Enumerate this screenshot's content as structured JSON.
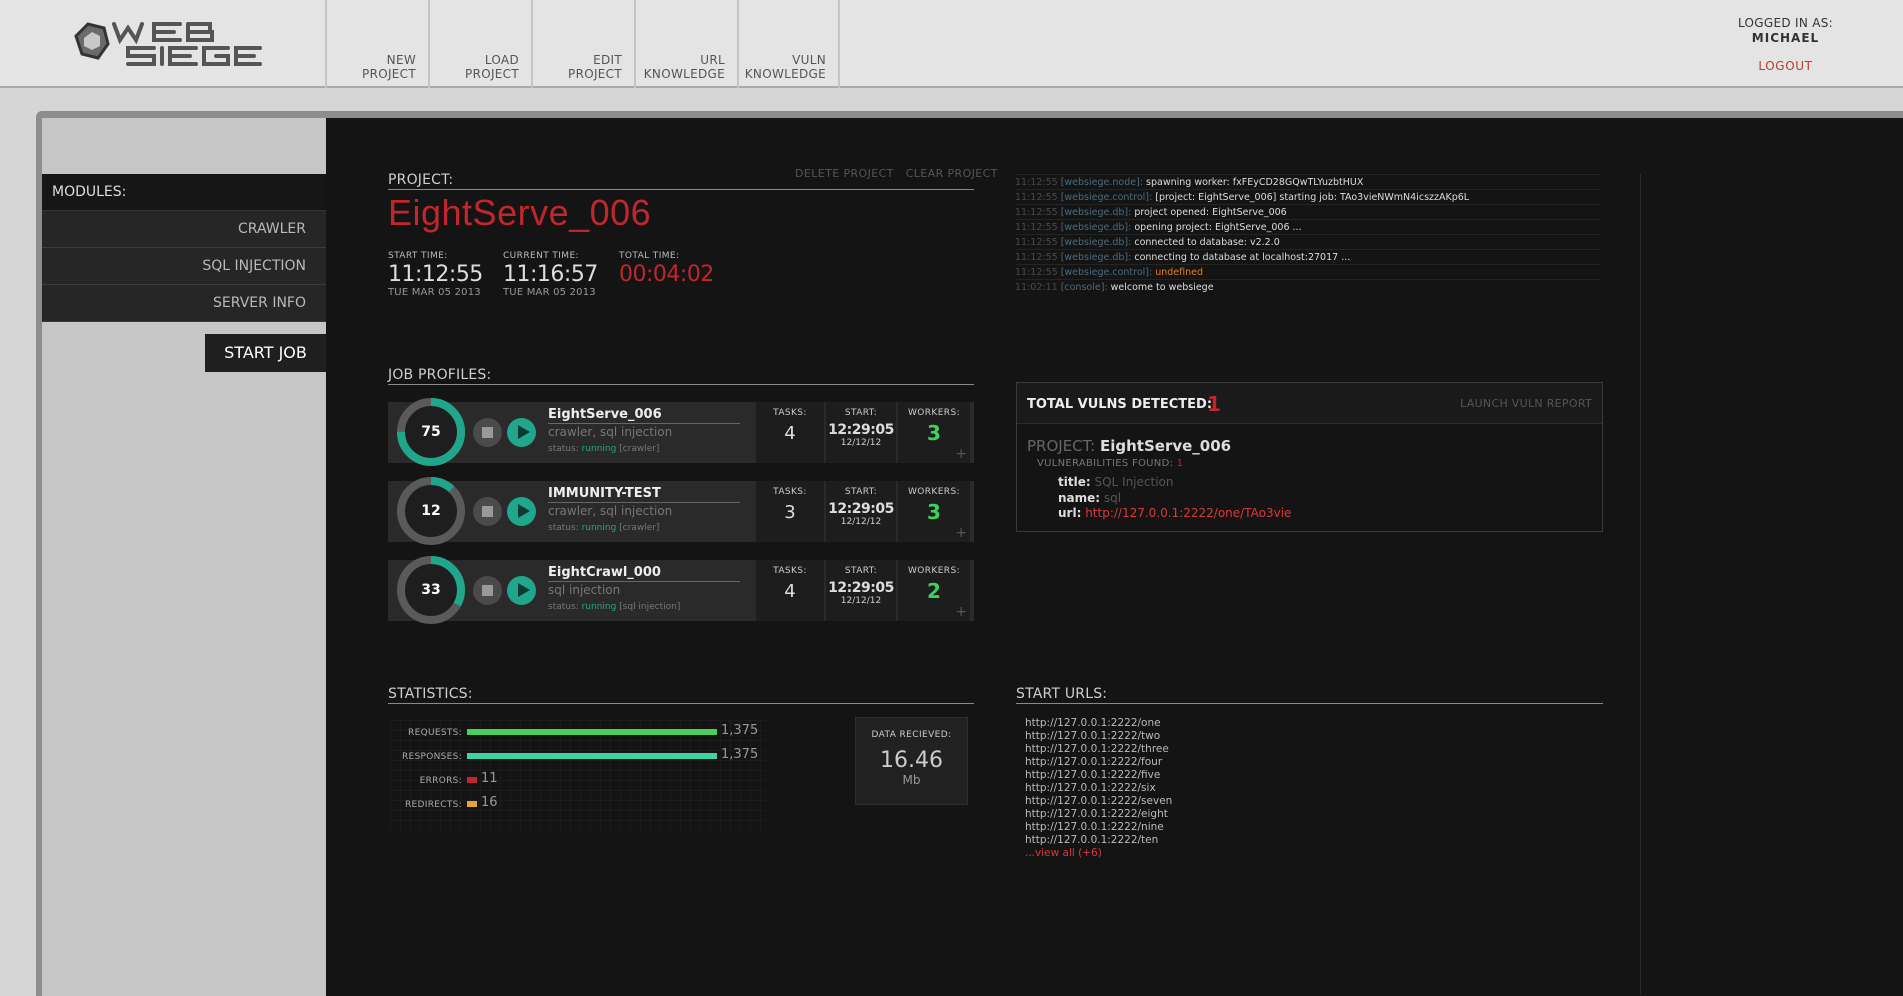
{
  "header": {
    "logo_text": "WEB SIEGE",
    "nav": [
      {
        "label": "NEW\nPROJECT"
      },
      {
        "label": "LOAD\nPROJECT"
      },
      {
        "label": "EDIT\nPROJECT"
      },
      {
        "label": "URL\nKNOWLEDGE"
      },
      {
        "label": "VULN\nKNOWLEDGE"
      }
    ],
    "user": {
      "logged_label": "LOGGED IN AS:",
      "name": "MICHAEL",
      "logout": "LOGOUT"
    }
  },
  "sidebar": {
    "title": "MODULES:",
    "items": [
      {
        "label": "CRAWLER"
      },
      {
        "label": "SQL INJECTION"
      },
      {
        "label": "SERVER INFO"
      }
    ],
    "start_job": "START JOB"
  },
  "project": {
    "section_label": "PROJECT:",
    "delete_label": "DELETE PROJECT",
    "clear_label": "CLEAR PROJECT",
    "name": "EightServe_006",
    "start": {
      "label": "START TIME:",
      "time": "11:12:55",
      "date": "TUE MAR 05 2013"
    },
    "current": {
      "label": "CURRENT TIME:",
      "time": "11:16:57",
      "date": "TUE MAR 05 2013"
    },
    "total": {
      "label": "TOTAL TIME:",
      "time": "00:04:02"
    }
  },
  "log": [
    {
      "ts": "11:12:55",
      "src": "[websiege.node]:",
      "msg": "spawning worker: fxFEyCD28GQwTLYuzbtHUX"
    },
    {
      "ts": "11:12:55",
      "src": "[websiege.control]:",
      "msg": "[project: EightServe_006] starting job: TAo3vieNWmN4icszzAKp6L"
    },
    {
      "ts": "11:12:55",
      "src": "[websiege.db]:",
      "msg": "project opened: EightServe_006"
    },
    {
      "ts": "11:12:55",
      "src": "[websiege.db]:",
      "msg": "opening project: EightServe_006 ..."
    },
    {
      "ts": "11:12:55",
      "src": "[websiege.db]:",
      "msg": "connected to database: v2.2.0"
    },
    {
      "ts": "11:12:55",
      "src": "[websiege.db]:",
      "msg": "connecting to database at localhost:27017 ..."
    },
    {
      "ts": "11:12:55",
      "src": "[websiege.control]:",
      "msg": "undefined",
      "warn": true
    },
    {
      "ts": "11:02:11",
      "src": "[console]:",
      "msg": "welcome to websiege"
    }
  ],
  "jobs": {
    "section_label": "JOB PROFILES:",
    "col_tasks": "TASKS:",
    "col_start": "START:",
    "col_workers": "WORKERS:",
    "items": [
      {
        "progress": 75,
        "name": "EightServe_006",
        "modules": "crawler, sql injection",
        "status_label": "status:",
        "status": "running",
        "status_detail": "[crawler]",
        "tasks": "4",
        "start_time": "12:29:05",
        "start_date": "12/12/12",
        "workers": "3"
      },
      {
        "progress": 12,
        "name": "IMMUNITY-TEST",
        "modules": "crawler, sql injection",
        "status_label": "status:",
        "status": "running",
        "status_detail": "[crawler]",
        "tasks": "3",
        "start_time": "12:29:05",
        "start_date": "12/12/12",
        "workers": "3"
      },
      {
        "progress": 33,
        "name": "EightCrawl_000",
        "modules": "sql injection",
        "status_label": "status:",
        "status": "running",
        "status_detail": "[sql injection]",
        "tasks": "4",
        "start_time": "12:29:05",
        "start_date": "12/12/12",
        "workers": "2"
      }
    ]
  },
  "vulns": {
    "title": "TOTAL VULNS DETECTED:",
    "count": "1",
    "launch": "LAUNCH VULN REPORT",
    "project_label": "PROJECT:",
    "project": "EightServe_006",
    "found_label": "VULNERABILITIES FOUND:",
    "found": "1",
    "title_key": "title:",
    "title_val": "SQL Injection",
    "name_key": "name:",
    "name_val": "sql",
    "url_key": "url:",
    "url_val": "http://127.0.0.1:2222/one/TAo3vie"
  },
  "statistics": {
    "section_label": "STATISTICS:",
    "rows": [
      {
        "label": "REQUESTS:",
        "value": "1,375",
        "fraction": 1.0,
        "color": "#4ccf58"
      },
      {
        "label": "RESPONSES:",
        "value": "1,375",
        "fraction": 1.0,
        "color": "#3fd3a5"
      },
      {
        "label": "ERRORS:",
        "value": "11",
        "fraction": 0.008,
        "color": "#c0272d"
      },
      {
        "label": "REDIRECTS:",
        "value": "16",
        "fraction": 0.012,
        "color": "#e5a13a"
      }
    ],
    "data": {
      "label": "DATA RECIEVED:",
      "value": "16.46",
      "unit": "Mb"
    }
  },
  "start_urls": {
    "section_label": "START URLS:",
    "urls": [
      "http://127.0.0.1:2222/one",
      "http://127.0.0.1:2222/two",
      "http://127.0.0.1:2222/three",
      "http://127.0.0.1:2222/four",
      "http://127.0.0.1:2222/five",
      "http://127.0.0.1:2222/six",
      "http://127.0.0.1:2222/seven",
      "http://127.0.0.1:2222/eight",
      "http://127.0.0.1:2222/nine",
      "http://127.0.0.1:2222/ten"
    ],
    "view_all": "...view all (+6)"
  },
  "colors": {
    "accent_red": "#c0272d",
    "accent_teal": "#20a68a",
    "workers_green": "#3fd05b"
  }
}
